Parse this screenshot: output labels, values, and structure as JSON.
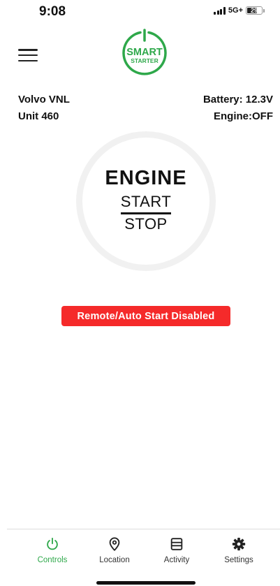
{
  "status_bar": {
    "time": "9:08",
    "network": "5G+",
    "battery_level": "29"
  },
  "header": {
    "logo_line1": "SMART",
    "logo_line2": "STARTER"
  },
  "vehicle": {
    "model": "Volvo VNL",
    "unit": "Unit 460",
    "battery": "Battery: 12.3V",
    "engine_status": "Engine:OFF"
  },
  "engine_control": {
    "title": "ENGINE",
    "start_label": "START",
    "stop_label": "STOP"
  },
  "alert": {
    "text": "Remote/Auto Start Disabled"
  },
  "tabs": [
    {
      "label": "Controls",
      "icon": "power-icon",
      "active": true
    },
    {
      "label": "Location",
      "icon": "location-pin-icon",
      "active": false
    },
    {
      "label": "Activity",
      "icon": "activity-list-icon",
      "active": false
    },
    {
      "label": "Settings",
      "icon": "gear-icon",
      "active": false
    }
  ],
  "colors": {
    "brand_green": "#2ea84a",
    "alert_red": "#f52a2a",
    "ring_gray": "#f1f1f1"
  }
}
